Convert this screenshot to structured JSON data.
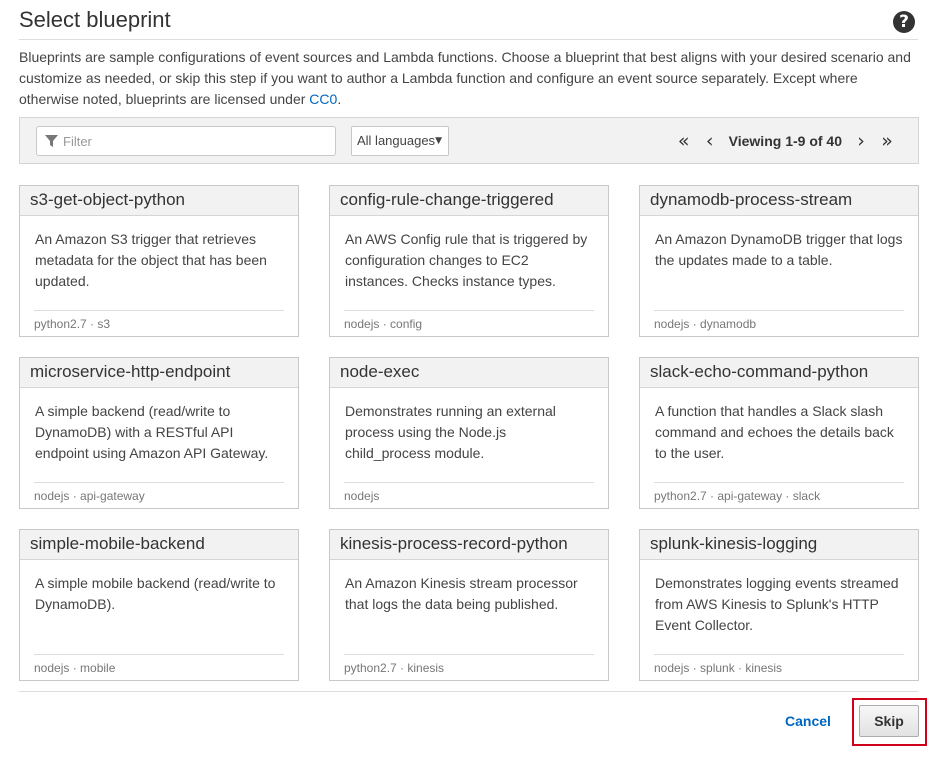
{
  "header": {
    "title": "Select blueprint",
    "help_icon": "question-circle-icon",
    "help_symbol": "?"
  },
  "intro": {
    "text": "Blueprints are sample configurations of event sources and Lambda functions. Choose a blueprint that best aligns with your desired scenario and customize as needed, or skip this step if you want to author a Lambda function and configure an event source separately. Except where otherwise noted, blueprints are licensed under ",
    "link_label": "CC0",
    "suffix": "."
  },
  "toolbar": {
    "filter_placeholder": "Filter",
    "filter_value": "",
    "language_selected": "All languages",
    "caret": "▼",
    "first_page": "«",
    "prev_page": "‹",
    "viewing_text": "Viewing 1-9 of 40",
    "next_page": "›",
    "last_page": "»"
  },
  "blueprints": [
    {
      "name": "s3-get-object-python",
      "description": "An Amazon S3 trigger that retrieves metadata for the object that has been updated.",
      "tags": "python2.7 · s3"
    },
    {
      "name": "config-rule-change-triggered",
      "description": "An AWS Config rule that is triggered by configuration changes to EC2 instances. Checks instance types.",
      "tags": "nodejs · config"
    },
    {
      "name": "dynamodb-process-stream",
      "description": "An Amazon DynamoDB trigger that logs the updates made to a table.",
      "tags": "nodejs · dynamodb"
    },
    {
      "name": "microservice-http-endpoint",
      "description": "A simple backend (read/write to DynamoDB) with a RESTful API endpoint using Amazon API Gateway.",
      "tags": "nodejs · api-gateway"
    },
    {
      "name": "node-exec",
      "description": "Demonstrates running an external process using the Node.js child_process module.",
      "tags": "nodejs"
    },
    {
      "name": "slack-echo-command-python",
      "description": "A function that handles a Slack slash command and echoes the details back to the user.",
      "tags": "python2.7 · api-gateway · slack"
    },
    {
      "name": "simple-mobile-backend",
      "description": "A simple mobile backend (read/write to DynamoDB).",
      "tags": "nodejs · mobile"
    },
    {
      "name": "kinesis-process-record-python",
      "description": "An Amazon Kinesis stream processor that logs the data being published.",
      "tags": "python2.7 · kinesis"
    },
    {
      "name": "splunk-kinesis-logging",
      "description": "Demonstrates logging events streamed from AWS Kinesis to Splunk's HTTP Event Collector.",
      "tags": "nodejs · splunk · kinesis"
    }
  ],
  "footer": {
    "cancel_label": "Cancel",
    "skip_label": "Skip",
    "highlight_color": "#d0021b"
  }
}
